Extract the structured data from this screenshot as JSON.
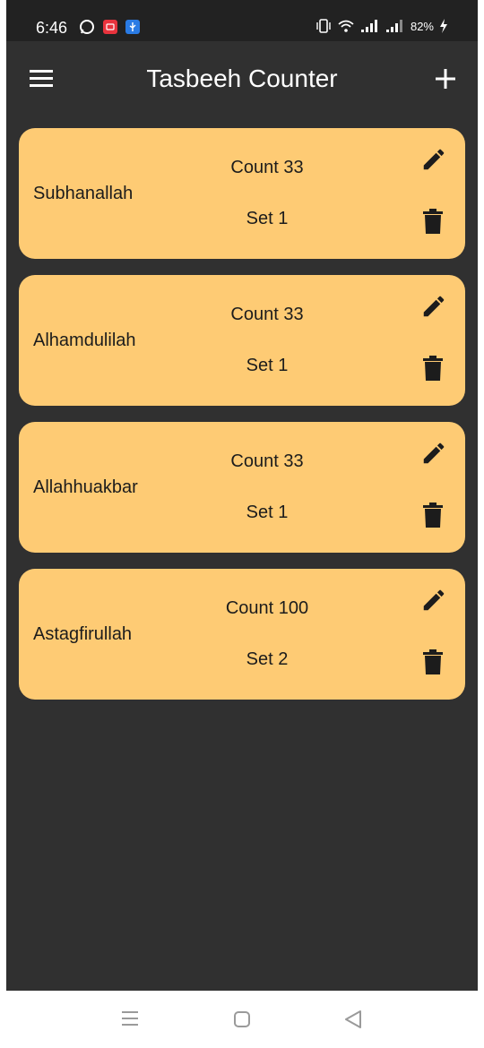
{
  "status_bar": {
    "time": "6:46",
    "battery": "82%"
  },
  "app_bar": {
    "title": "Tasbeeh Counter"
  },
  "colors": {
    "background": "#303030",
    "card": "#fecb74",
    "status_bar": "#222222"
  },
  "icons": [
    "whatsapp-icon",
    "screen-record-icon",
    "usb-icon",
    "vibrate-icon",
    "wifi-icon",
    "signal-icon",
    "battery-charging-icon",
    "menu-icon",
    "add-icon",
    "edit-icon",
    "delete-icon",
    "nav-recents-icon",
    "nav-home-icon",
    "nav-back-icon"
  ],
  "counters": [
    {
      "name": "Subhanallah",
      "count": "Count 33",
      "set": "Set 1"
    },
    {
      "name": "Alhamdulilah",
      "count": "Count 33",
      "set": "Set 1"
    },
    {
      "name": "Allahhuakbar",
      "count": "Count 33",
      "set": "Set 1"
    },
    {
      "name": "Astagfirullah",
      "count": "Count 100",
      "set": "Set 2"
    }
  ]
}
